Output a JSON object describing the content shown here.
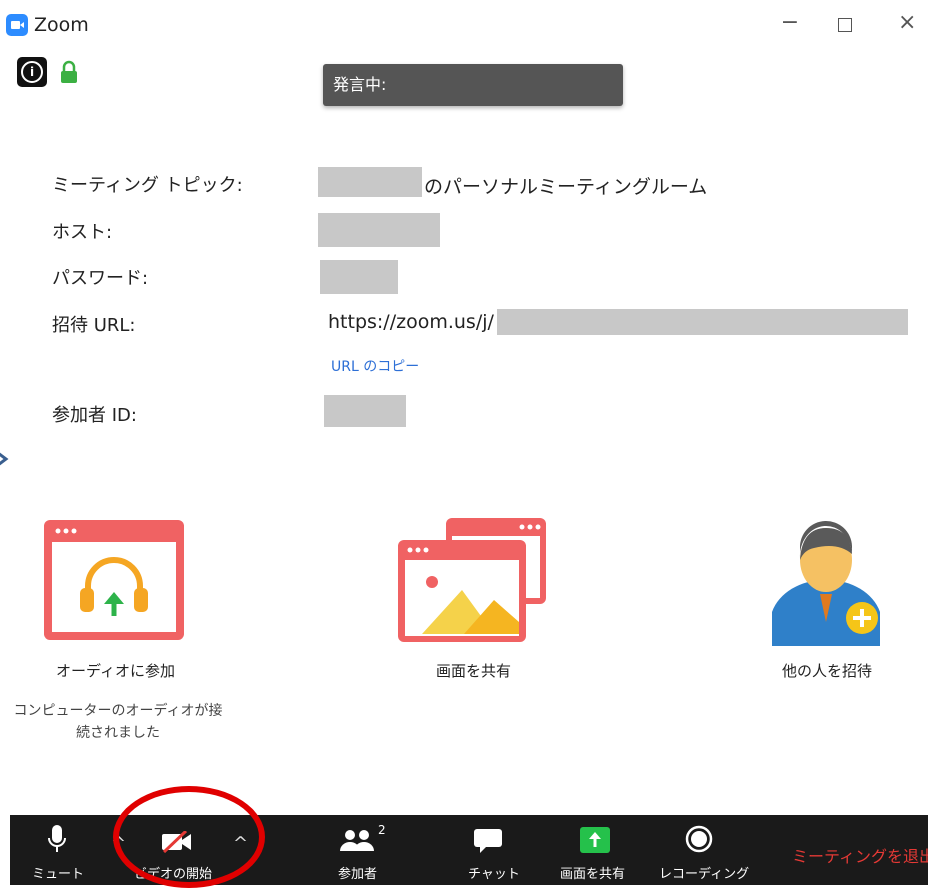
{
  "window": {
    "title": "Zoom",
    "minimize": "−",
    "close": "×"
  },
  "speaking": {
    "label": "発言中:"
  },
  "info": {
    "topic_label": "ミーティング トピック:",
    "topic_suffix": "のパーソナルミーティングルーム",
    "host_label": "ホスト:",
    "password_label": "パスワード:",
    "url_label": "招待 URL:",
    "url_value": "https://zoom.us/j/",
    "copy_url": "URL のコピー",
    "participant_id_label": "参加者 ID:"
  },
  "actions": {
    "join_audio": "オーディオに参加",
    "share_screen": "画面を共有",
    "invite": "他の人を招待",
    "audio_status": [
      "コンピューターのオーディオが接",
      "続されました"
    ]
  },
  "toolbar": {
    "mute": "ミュート",
    "start_video": "ビデオの開始",
    "participants": "参加者",
    "participants_count": "2",
    "chat": "チャット",
    "share_screen": "画面を共有",
    "recording": "レコーディング",
    "leave": "ミーティングを退出"
  },
  "colors": {
    "accent_blue": "#2d8cff",
    "card_red": "#f06263",
    "leave_red": "#e53935",
    "share_green": "#25c14b",
    "toolbar_bg": "#1a1a1a"
  }
}
